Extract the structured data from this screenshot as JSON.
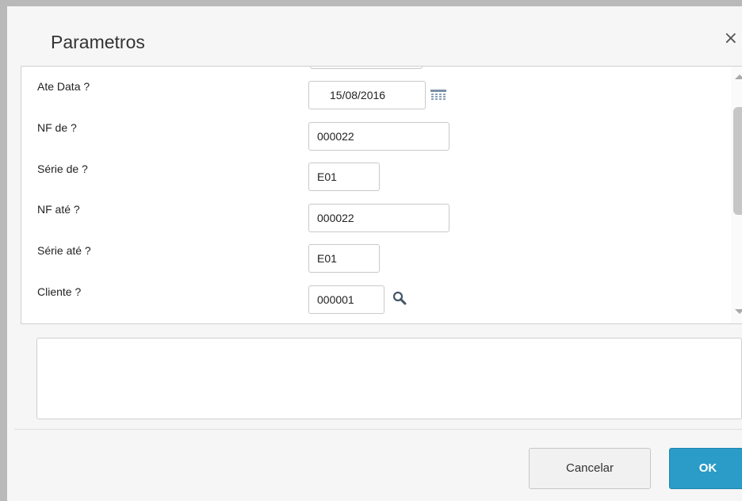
{
  "dialog": {
    "title": "Parametros",
    "close_glyph": "×"
  },
  "form": {
    "rows": [
      {
        "label": "Ate Data ?",
        "value": "15/08/2016",
        "icon": "calendar-icon"
      },
      {
        "label": "NF de ?",
        "value": "000022"
      },
      {
        "label": "Série de ?",
        "value": "E01"
      },
      {
        "label": "NF até ?",
        "value": "000022"
      },
      {
        "label": "Série até ?",
        "value": "E01"
      },
      {
        "label": "Cliente ?",
        "value": "000001",
        "icon": "search-icon"
      }
    ]
  },
  "footer": {
    "cancel_label": "Cancelar",
    "ok_label": "OK"
  },
  "colors": {
    "accent": "#2b9bc7",
    "background": "#f6f6f6"
  }
}
